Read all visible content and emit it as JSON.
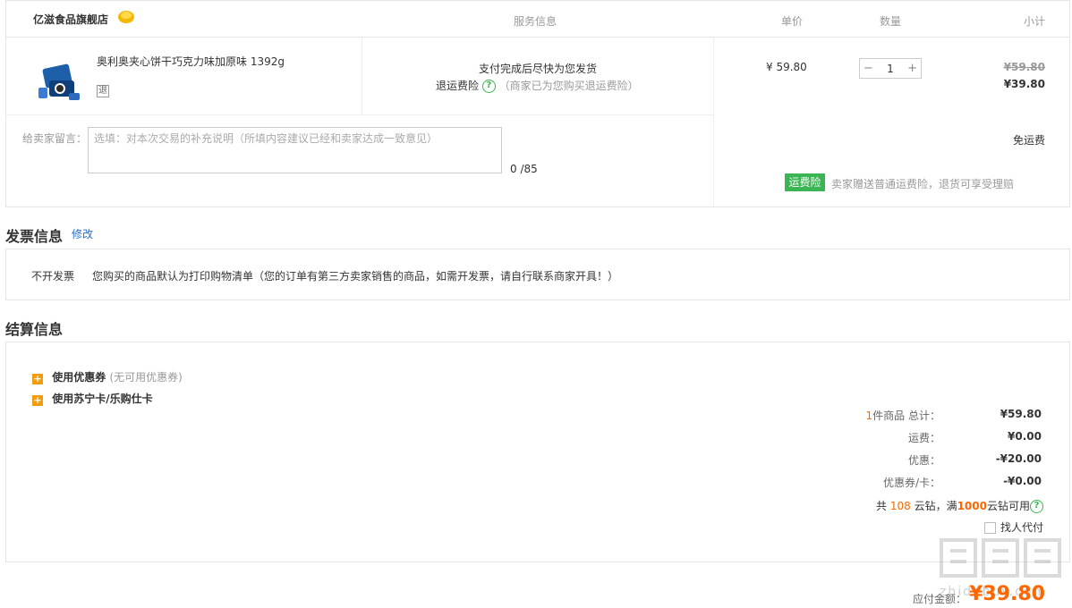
{
  "header": {
    "shop_name": "亿滋食品旗舰店",
    "col_service": "服务信息",
    "col_price": "单价",
    "col_qty": "数量",
    "col_subtotal": "小计"
  },
  "product": {
    "name": "奥利奥夹心饼干巧克力味加原味 1392g",
    "refund_icon": "退",
    "service_line1": "支付完成后尽快为您发货",
    "service_line2_label": "退运费险",
    "service_line2_note": "（商家已为您购买退运费险）",
    "unit_price": "¥ 59.80",
    "qty_minus": "−",
    "qty": "1",
    "qty_plus": "+",
    "subtotal_old": "¥59.80",
    "subtotal_new": "¥39.80"
  },
  "message": {
    "label": "给卖家留言：",
    "placeholder": "选填：对本次交易的补充说明（所填内容建议已经和卖家达成一致意见）",
    "count": "0 /85"
  },
  "shipping": {
    "free": "免运费",
    "tag": "运费险",
    "note": "卖家赠送普通运费险，退货可享受理赔"
  },
  "invoice": {
    "title": "发票信息",
    "edit": "修改",
    "type": "不开发票",
    "note": "您购买的商品默认为打印购物清单（您的订单有第三方卖家销售的商品，如需开发票，请自行联系商家开具！）"
  },
  "settlement": {
    "title": "结算信息",
    "coupon_label": "使用优惠券",
    "coupon_note": "(无可用优惠券)",
    "card_label": "使用苏宁卡/乐购仕卡",
    "items_count": "1",
    "items_label": "件商品 总计：",
    "total": "¥59.80",
    "freight_label": "运费：",
    "freight": "¥0.00",
    "discount_label": "优惠：",
    "discount": "-¥20.00",
    "card_discount_label": "优惠券/卡：",
    "card_discount": "-¥0.00",
    "diamond_pre": "共",
    "diamond_count": "108",
    "diamond_mid": "云钻，满",
    "diamond_min": "1000",
    "diamond_post": "云钻可用",
    "proxy_pay": "找人代付"
  },
  "due": {
    "label": "应付金额：",
    "amount": "¥39.80"
  },
  "watermark": "zhidebuy.com",
  "colors": {
    "accent": "#ff6600",
    "green": "#3bb553",
    "link": "#2a6fcc",
    "plus": "#f39c12"
  },
  "icons": [
    "shop-badge-icon",
    "question-icon",
    "plus-icon",
    "refund-icon"
  ]
}
